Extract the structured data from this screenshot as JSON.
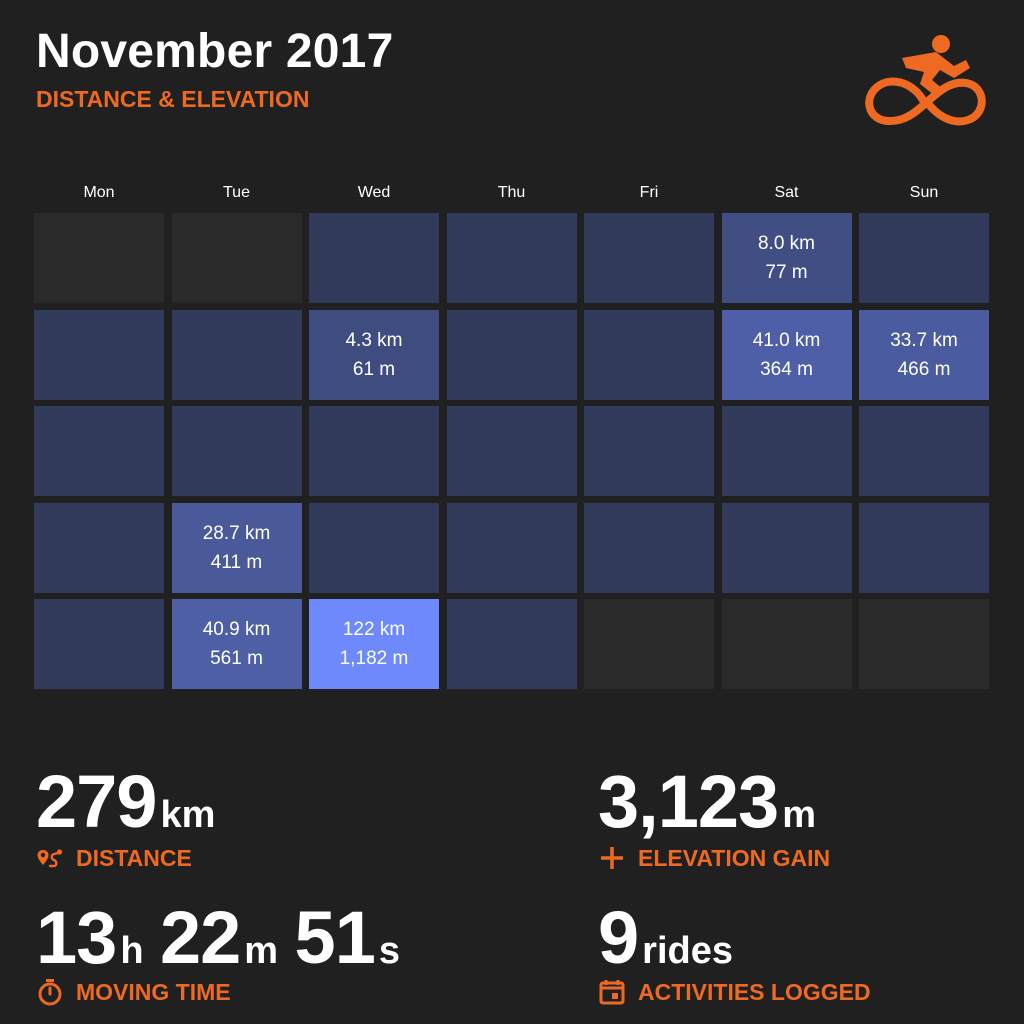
{
  "header": {
    "title": "November 2017",
    "subtitle": "DISTANCE & ELEVATION",
    "logo_icon": "cyclist-icon",
    "accent_color": "#ee6a23"
  },
  "calendar": {
    "weekdays": [
      "Mon",
      "Tue",
      "Wed",
      "Thu",
      "Fri",
      "Sat",
      "Sun"
    ],
    "empty_color": "#2a2a2a",
    "base_color": "#323a5c",
    "max_color": "#6d89fb",
    "max_distance_km": 122,
    "cells": [
      {
        "empty": true
      },
      {
        "empty": true
      },
      {},
      {},
      {},
      {
        "distance": "8.0 km",
        "elevation": "77 m",
        "km": 8.0
      },
      {},
      {},
      {},
      {
        "distance": "4.3 km",
        "elevation": "61 m",
        "km": 4.3
      },
      {},
      {},
      {
        "distance": "41.0 km",
        "elevation": "364 m",
        "km": 41.0
      },
      {
        "distance": "33.7 km",
        "elevation": "466 m",
        "km": 33.7
      },
      {},
      {},
      {},
      {},
      {},
      {},
      {},
      {},
      {
        "distance": "28.7 km",
        "elevation": "411 m",
        "km": 28.7
      },
      {},
      {},
      {},
      {},
      {},
      {},
      {
        "distance": "40.9 km",
        "elevation": "561 m",
        "km": 40.9
      },
      {
        "distance": "122 km",
        "elevation": "1,182 m",
        "km": 122
      },
      {},
      {
        "empty": true
      },
      {
        "empty": true
      },
      {
        "empty": true
      }
    ]
  },
  "stats": {
    "distance": {
      "value": "279",
      "unit": "km",
      "label": "DISTANCE",
      "icon": "route-pin-icon"
    },
    "elevation": {
      "value": "3,123",
      "unit": "m",
      "label": "ELEVATION GAIN",
      "icon": "plus-icon"
    },
    "moving_time": {
      "hours": "13",
      "h_unit": "h",
      "minutes": "22",
      "m_unit": "m",
      "seconds": "51",
      "s_unit": "s",
      "label": "MOVING TIME",
      "icon": "stopwatch-icon"
    },
    "activities": {
      "value": "9",
      "unit": "rides",
      "label": "ACTIVITIES LOGGED",
      "icon": "calendar-icon"
    }
  }
}
